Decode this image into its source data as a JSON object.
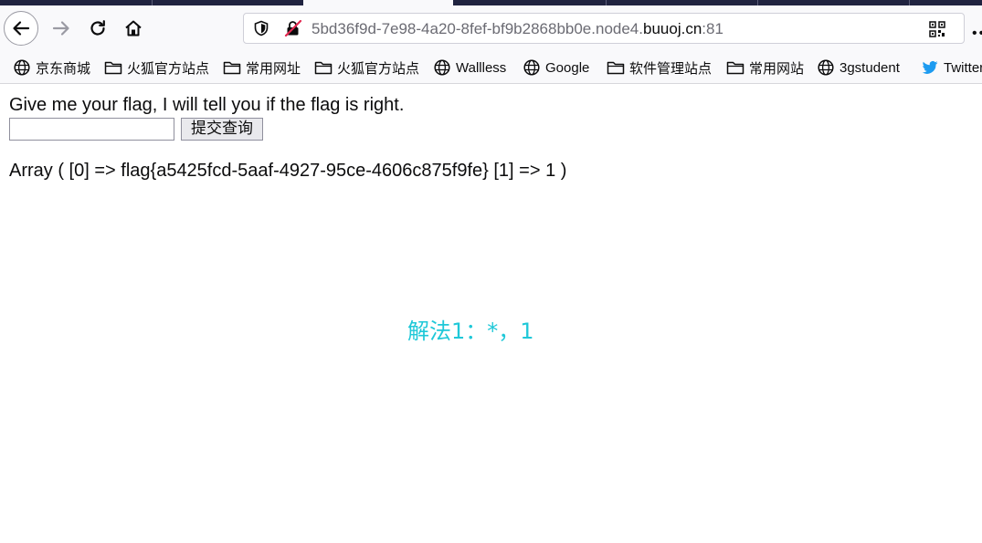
{
  "browser": {
    "url_prefix": "5bd36f9d-7e98-4a20-8fef-bf9b2868bb0e.node4.",
    "url_host": "buuoj.cn",
    "url_port": ":81",
    "overflow_label": "••"
  },
  "bookmarks": [
    {
      "label": "京东商城",
      "icon": "globe-icon"
    },
    {
      "label": "火狐官方站点",
      "icon": "folder-icon"
    },
    {
      "label": "常用网址",
      "icon": "folder-icon"
    },
    {
      "label": "火狐官方站点",
      "icon": "folder-icon"
    },
    {
      "label": "Wallless",
      "icon": "globe-icon"
    },
    {
      "label": "Google",
      "icon": "globe-icon"
    },
    {
      "label": "软件管理站点",
      "icon": "folder-icon"
    },
    {
      "label": "常用网站",
      "icon": "folder-icon"
    },
    {
      "label": "3gstudent",
      "icon": "globe-icon"
    },
    {
      "label": "Twitter",
      "icon": "twitter-bird-icon"
    }
  ],
  "page": {
    "prompt": "Give me your flag, I will tell you if the flag is right.",
    "input_value": "",
    "submit_label": "提交查询",
    "result": "Array ( [0] => flag{a5425fcd-5aaf-4927-95ce-4606c875f9fe} [1] => 1 )"
  },
  "annotation": {
    "text": "解法1：*，1",
    "color": "#1fc8d8"
  },
  "colors": {
    "tabstrip": "#202340",
    "toolbar": "#f9f9fb",
    "annotation": "#1fc8d8"
  }
}
